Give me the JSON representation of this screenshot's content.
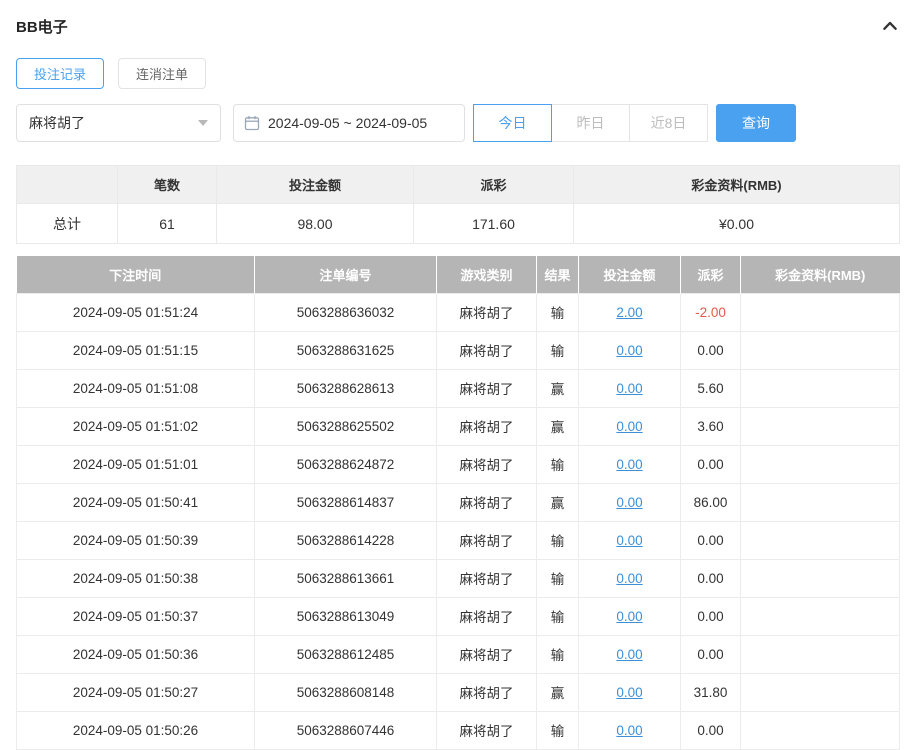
{
  "colors": {
    "accent": "#4aa1f0",
    "link": "#3d8fd8",
    "negative": "#e25a4d",
    "table_header_bg": "#b5b5b5",
    "summary_header_bg": "#f0f0f0"
  },
  "header": {
    "title": "BB电子"
  },
  "tabs": [
    {
      "label": "投注记录",
      "active": true
    },
    {
      "label": "连消注单",
      "active": false
    }
  ],
  "filters": {
    "game_select": {
      "value": "麻将胡了"
    },
    "date_range": {
      "value": "2024-09-05 ~ 2024-09-05"
    },
    "quick_buttons": [
      {
        "label": "今日",
        "active": true
      },
      {
        "label": "昨日",
        "active": false
      },
      {
        "label": "近8日",
        "active": false
      }
    ],
    "search_label": "查询"
  },
  "summary": {
    "headers": [
      "",
      "笔数",
      "投注金额",
      "派彩",
      "彩金资料(RMB)"
    ],
    "total_label": "总计",
    "count": "61",
    "bet_amount": "98.00",
    "payout": "171.60",
    "bonus": "¥0.00"
  },
  "table": {
    "headers": [
      "下注时间",
      "注单编号",
      "游戏类别",
      "结果",
      "投注金额",
      "派彩",
      "彩金资料(RMB)"
    ],
    "rows": [
      {
        "time": "2024-09-05 01:51:24",
        "order": "5063288636032",
        "game": "麻将胡了",
        "result": "输",
        "bet": "2.00",
        "payout": "-2.00",
        "bonus": ""
      },
      {
        "time": "2024-09-05 01:51:15",
        "order": "5063288631625",
        "game": "麻将胡了",
        "result": "输",
        "bet": "0.00",
        "payout": "0.00",
        "bonus": ""
      },
      {
        "time": "2024-09-05 01:51:08",
        "order": "5063288628613",
        "game": "麻将胡了",
        "result": "赢",
        "bet": "0.00",
        "payout": "5.60",
        "bonus": ""
      },
      {
        "time": "2024-09-05 01:51:02",
        "order": "5063288625502",
        "game": "麻将胡了",
        "result": "赢",
        "bet": "0.00",
        "payout": "3.60",
        "bonus": ""
      },
      {
        "time": "2024-09-05 01:51:01",
        "order": "5063288624872",
        "game": "麻将胡了",
        "result": "输",
        "bet": "0.00",
        "payout": "0.00",
        "bonus": ""
      },
      {
        "time": "2024-09-05 01:50:41",
        "order": "5063288614837",
        "game": "麻将胡了",
        "result": "赢",
        "bet": "0.00",
        "payout": "86.00",
        "bonus": ""
      },
      {
        "time": "2024-09-05 01:50:39",
        "order": "5063288614228",
        "game": "麻将胡了",
        "result": "输",
        "bet": "0.00",
        "payout": "0.00",
        "bonus": ""
      },
      {
        "time": "2024-09-05 01:50:38",
        "order": "5063288613661",
        "game": "麻将胡了",
        "result": "输",
        "bet": "0.00",
        "payout": "0.00",
        "bonus": ""
      },
      {
        "time": "2024-09-05 01:50:37",
        "order": "5063288613049",
        "game": "麻将胡了",
        "result": "输",
        "bet": "0.00",
        "payout": "0.00",
        "bonus": ""
      },
      {
        "time": "2024-09-05 01:50:36",
        "order": "5063288612485",
        "game": "麻将胡了",
        "result": "输",
        "bet": "0.00",
        "payout": "0.00",
        "bonus": ""
      },
      {
        "time": "2024-09-05 01:50:27",
        "order": "5063288608148",
        "game": "麻将胡了",
        "result": "赢",
        "bet": "0.00",
        "payout": "31.80",
        "bonus": ""
      },
      {
        "time": "2024-09-05 01:50:26",
        "order": "5063288607446",
        "game": "麻将胡了",
        "result": "输",
        "bet": "0.00",
        "payout": "0.00",
        "bonus": ""
      }
    ]
  }
}
